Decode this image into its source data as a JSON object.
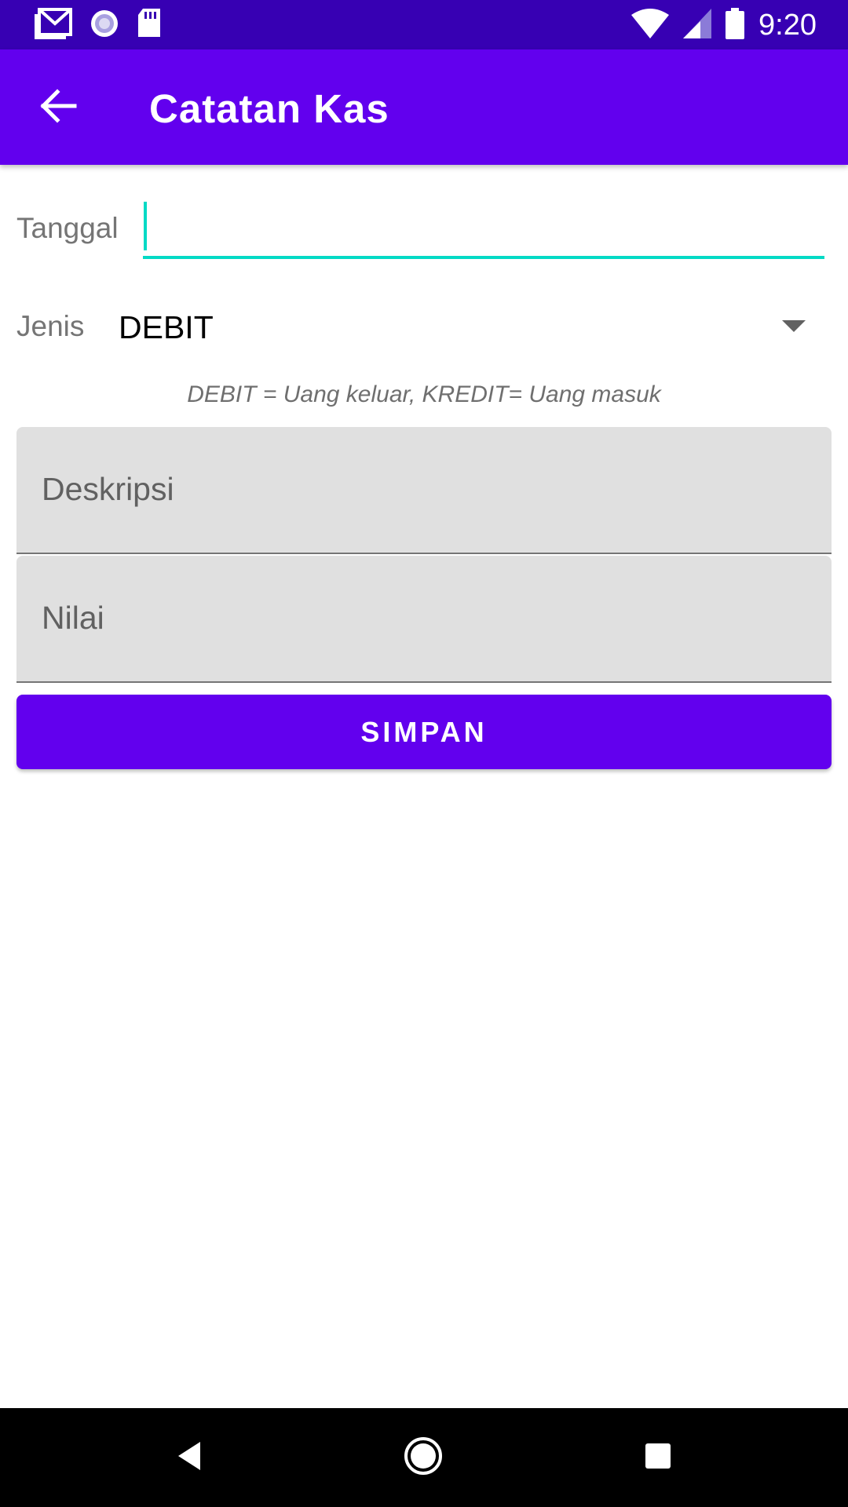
{
  "status_bar": {
    "time": "9:20",
    "icons_left": [
      "gmail-icon",
      "sync-icon",
      "sd-card-icon"
    ],
    "icons_right": [
      "wifi-icon",
      "signal-icon",
      "battery-icon"
    ],
    "color": "#3700b3"
  },
  "app_bar": {
    "title": "Catatan Kas",
    "back_icon": "arrow-back-icon",
    "color": "#6200ee"
  },
  "form": {
    "tanggal": {
      "label": "Tanggal",
      "value": ""
    },
    "jenis": {
      "label": "Jenis",
      "selected": "DEBIT"
    },
    "hint": "DEBIT = Uang keluar, KREDIT= Uang masuk",
    "deskripsi": {
      "placeholder": "Deskripsi"
    },
    "nilai": {
      "placeholder": "Nilai"
    },
    "save_label": "SIMPAN"
  },
  "nav_bar": {
    "icons": [
      "back-nav-icon",
      "home-nav-icon",
      "recents-nav-icon"
    ]
  },
  "colors": {
    "accent": "#03dac5",
    "primary": "#6200ee",
    "primary_dark": "#3700b3"
  }
}
